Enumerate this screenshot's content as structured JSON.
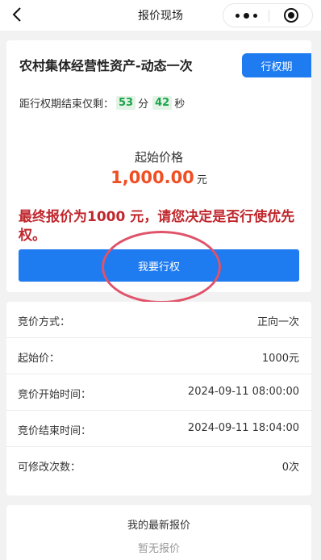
{
  "nav": {
    "title": "报价现场"
  },
  "auction": {
    "title": "农村集体经营性资产-动态一次",
    "phase_tag": "行权期",
    "countdown": {
      "prefix": "距行权期结束仅剩：",
      "minutes": "53",
      "minutes_unit": "分",
      "seconds": "42",
      "seconds_unit": "秒"
    },
    "start_price_label": "起始价格",
    "start_price_value": "1,000.00",
    "start_price_unit": "元",
    "notice": "最终报价为1000 元，请您决定是否行使优先权。",
    "exercise_button": "我要行权"
  },
  "details": [
    {
      "label": "竞价方式：",
      "value": "正向一次"
    },
    {
      "label": "起始价：",
      "value": "1000元"
    },
    {
      "label": "竞价开始时间：",
      "value": "2024-09-11 08:00:00"
    },
    {
      "label": "竞价结束时间：",
      "value": "2024-09-11 18:04:00"
    },
    {
      "label": "可修改次数：",
      "value": "0次"
    }
  ],
  "my_bid": {
    "title": "我的最新报价",
    "empty_text": "暂无报价"
  },
  "colors": {
    "primary": "#1e7bf0",
    "price": "#f04e23",
    "notice": "#c0272d",
    "countdown_green": "#1aa34a",
    "annotation_circle": "#e0536a"
  }
}
